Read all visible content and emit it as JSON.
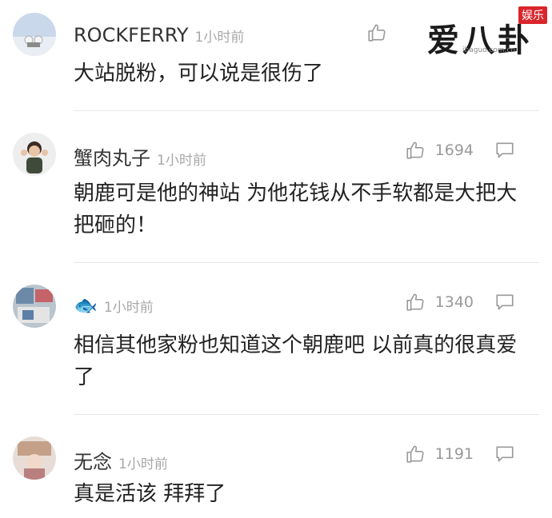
{
  "watermark": {
    "main": "爱八卦",
    "badge": "娱乐",
    "site": "ibaguo.com.cn"
  },
  "comments": [
    {
      "username": "ROCKFERRY",
      "time": "1小时前",
      "likes": "",
      "text": "大站脱粉，可以说是很伤了"
    },
    {
      "username": "蟹肉丸子",
      "time": "1小时前",
      "likes": "1694",
      "text": "朝鹿可是他的神站 为他花钱从不手软都是大把大把砸的！"
    },
    {
      "username": "🐟",
      "time": "1小时前",
      "likes": "1340",
      "text": "相信其他家粉也知道这个朝鹿吧  以前真的很真爱了"
    },
    {
      "username": "无念",
      "time": "1小时前",
      "likes": "1191",
      "text": "真是活该 拜拜了"
    }
  ]
}
